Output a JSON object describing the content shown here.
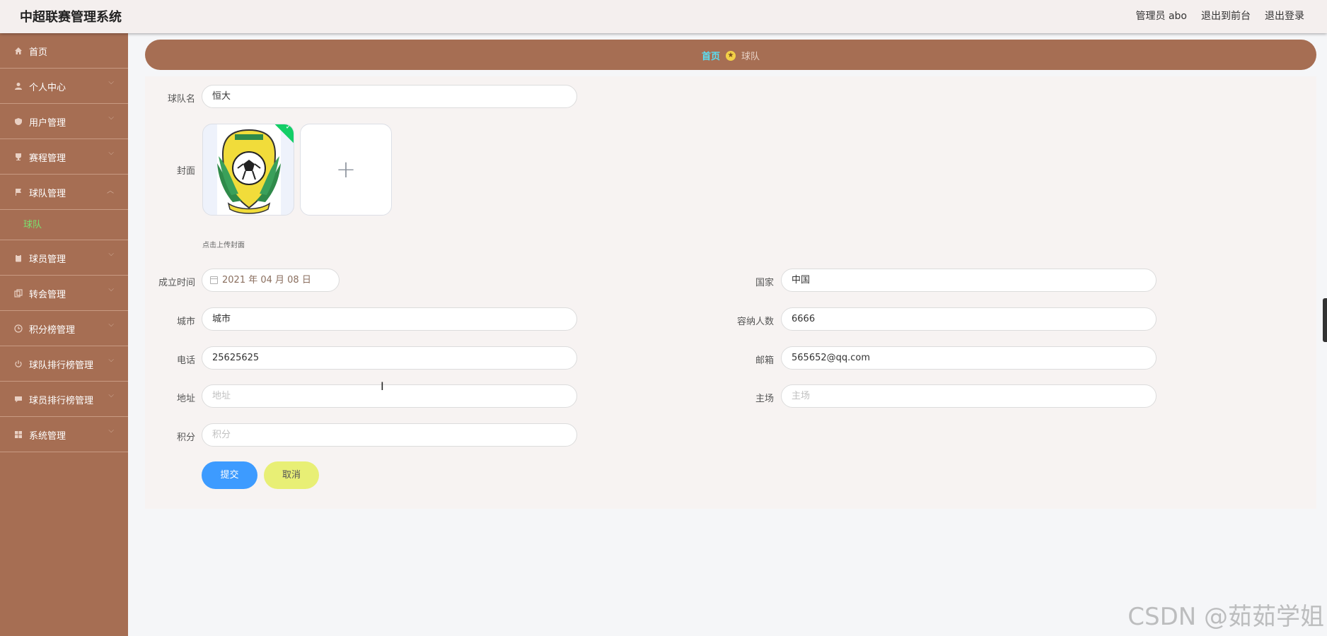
{
  "header": {
    "title": "中超联赛管理系统",
    "admin": "管理员 abo",
    "to_frontend": "退出到前台",
    "logout": "退出登录"
  },
  "sidebar": {
    "items": [
      {
        "label": "首页",
        "icon": "home-icon"
      },
      {
        "label": "个人中心",
        "icon": "user-icon"
      },
      {
        "label": "用户管理",
        "icon": "shield-icon"
      },
      {
        "label": "赛程管理",
        "icon": "trophy-icon"
      },
      {
        "label": "球队管理",
        "icon": "flag-icon",
        "sub": "球队"
      },
      {
        "label": "球员管理",
        "icon": "clipboard-icon"
      },
      {
        "label": "转会管理",
        "icon": "copy-icon"
      },
      {
        "label": "积分榜管理",
        "icon": "clock-icon"
      },
      {
        "label": "球队排行榜管理",
        "icon": "power-icon"
      },
      {
        "label": "球员排行榜管理",
        "icon": "chat-icon"
      },
      {
        "label": "系统管理",
        "icon": "grid-icon"
      }
    ]
  },
  "breadcrumb": {
    "home": "首页",
    "current": "球队"
  },
  "form": {
    "team_name": {
      "label": "球队名",
      "value": "恒大"
    },
    "cover": {
      "label": "封面",
      "hint": "点击上传封面"
    },
    "founded": {
      "label": "成立时间",
      "value": "2021 年 04 月 08 日"
    },
    "country": {
      "label": "国家",
      "value": "中国"
    },
    "city": {
      "label": "城市",
      "value": "城市"
    },
    "capacity": {
      "label": "容纳人数",
      "value": "6666"
    },
    "phone": {
      "label": "电话",
      "value": "25625625"
    },
    "email": {
      "label": "邮箱",
      "value": "565652@qq.com"
    },
    "address": {
      "label": "地址",
      "placeholder": "地址"
    },
    "home_ground": {
      "label": "主场",
      "placeholder": "主场"
    },
    "points": {
      "label": "积分",
      "placeholder": "积分"
    },
    "submit": "提交",
    "cancel": "取消"
  },
  "watermark": "CSDN @茹茹学姐",
  "colors": {
    "sidebar": "#a66e53",
    "submit": "#3d9bff",
    "cancel": "#e8ef75",
    "active_sub": "#7be06e"
  }
}
